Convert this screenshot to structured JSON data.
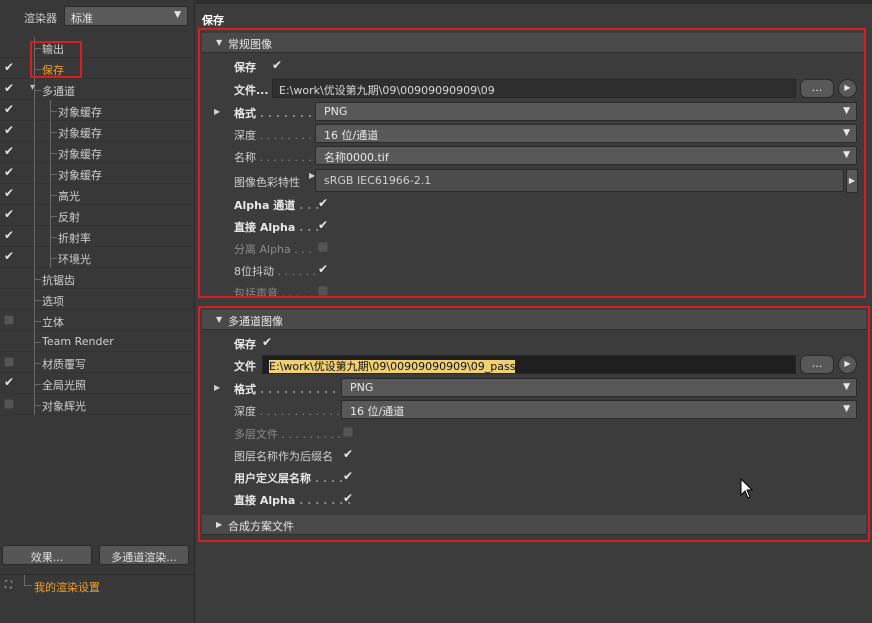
{
  "renderer": {
    "label": "渲染器",
    "value": "标准"
  },
  "tree": [
    {
      "label": "输出",
      "checked": false,
      "checkbox": "none",
      "indent": 1,
      "active": false
    },
    {
      "label": "保存",
      "checked": true,
      "checkbox": "check",
      "indent": 1,
      "active": true
    },
    {
      "label": "多通道",
      "checked": true,
      "checkbox": "check",
      "indent": 1,
      "active": false
    },
    {
      "label": "对象缓存",
      "checked": true,
      "checkbox": "check",
      "indent": 2,
      "active": false
    },
    {
      "label": "对象缓存",
      "checked": true,
      "checkbox": "check",
      "indent": 2,
      "active": false
    },
    {
      "label": "对象缓存",
      "checked": true,
      "checkbox": "check",
      "indent": 2,
      "active": false
    },
    {
      "label": "对象缓存",
      "checked": true,
      "checkbox": "check",
      "indent": 2,
      "active": false
    },
    {
      "label": "高光",
      "checked": true,
      "checkbox": "check",
      "indent": 2,
      "active": false
    },
    {
      "label": "反射",
      "checked": true,
      "checkbox": "check",
      "indent": 2,
      "active": false
    },
    {
      "label": "折射率",
      "checked": true,
      "checkbox": "check",
      "indent": 2,
      "active": false
    },
    {
      "label": "环境光",
      "checked": true,
      "checkbox": "check",
      "indent": 2,
      "active": false
    },
    {
      "label": "抗锯齿",
      "checked": false,
      "checkbox": "none",
      "indent": 1,
      "active": false
    },
    {
      "label": "选项",
      "checked": false,
      "checkbox": "none",
      "indent": 1,
      "active": false
    },
    {
      "label": "立体",
      "checked": false,
      "checkbox": "box",
      "indent": 1,
      "active": false
    },
    {
      "label": "Team Render",
      "checked": false,
      "checkbox": "none",
      "indent": 1,
      "active": false
    },
    {
      "label": "材质覆写",
      "checked": false,
      "checkbox": "box",
      "indent": 1,
      "active": false
    },
    {
      "label": "全局光照",
      "checked": true,
      "checkbox": "check",
      "indent": 1,
      "active": false
    },
    {
      "label": "对象辉光",
      "checked": false,
      "checkbox": "box",
      "indent": 1,
      "active": false
    }
  ],
  "buttons": {
    "effects": "效果...",
    "multipass": "多通道渲染..."
  },
  "settings": {
    "label": "我的渲染设置"
  },
  "page_title": "保存",
  "regular": {
    "header": "常规图像",
    "save_label": "保存",
    "file_label": "文件...",
    "file_value": "E:\\work\\优设第九期\\09\\00909090909\\09",
    "format_label": "格式",
    "format_value": "PNG",
    "depth_label": "深度",
    "depth_value": "16 位/通道",
    "name_label": "名称",
    "name_value": "名称0000.tif",
    "profile_label": "图像色彩特性",
    "profile_value": "sRGB IEC61966-2.1",
    "alpha_label": "Alpha 通道",
    "straight_alpha_label": "直接 Alpha",
    "separate_alpha_label": "分离 Alpha",
    "dither_label": "8位抖动",
    "include_sound_label": "包括声音",
    "ellipsis": "..."
  },
  "multipass": {
    "header": "多通道图像",
    "save_label": "保存",
    "file_label": "文件",
    "file_value_main": "E:\\work\\优设第九期\\09\\00909090909\\09_pass",
    "format_label": "格式",
    "format_value": "PNG",
    "depth_label": "深度",
    "depth_value": "16 位/通道",
    "layered_label": "多层文件",
    "layer_suffix_label": "图层名称作为后缀名",
    "user_layer_label": "用户定义层名称",
    "straight_alpha_label": "直接 Alpha",
    "ellipsis": "..."
  },
  "composite": {
    "header": "合成方案文件"
  },
  "icons": {
    "check": "✔",
    "tri_down": "▾",
    "tri_right": "▸",
    "play": "▶"
  }
}
